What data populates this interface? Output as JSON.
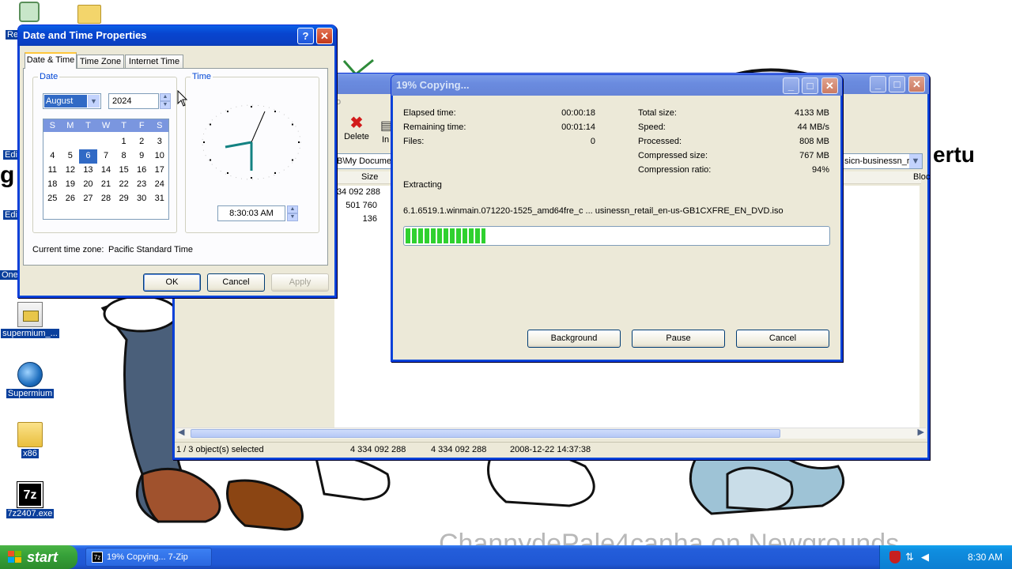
{
  "desktop": {
    "icons": [
      {
        "label": "supermium_...",
        "icon": "installer-icon"
      },
      {
        "label": "Supermium",
        "icon": "browser-icon"
      },
      {
        "label": "x86",
        "icon": "folder-icon"
      },
      {
        "label": "7z2407.exe",
        "icon": "7zip-icon"
      }
    ],
    "cut_labels": [
      "Re",
      "Edi",
      "Edi",
      "One"
    ],
    "wallpaper_text": "ChannydePale4canha on Newgrounds",
    "bg_word": "ertu"
  },
  "datetime": {
    "title": "Date and Time Properties",
    "tabs": [
      "Date & Time",
      "Time Zone",
      "Internet Time"
    ],
    "date_legend": "Date",
    "time_legend": "Time",
    "month": "August",
    "year": "2024",
    "weekdays": [
      "S",
      "M",
      "T",
      "W",
      "T",
      "F",
      "S"
    ],
    "calendar_rows": [
      [
        "",
        "",
        "",
        "",
        "1",
        "2",
        "3"
      ],
      [
        "4",
        "5",
        "6",
        "7",
        "8",
        "9",
        "10"
      ],
      [
        "11",
        "12",
        "13",
        "14",
        "15",
        "16",
        "17"
      ],
      [
        "18",
        "19",
        "20",
        "21",
        "22",
        "23",
        "24"
      ],
      [
        "25",
        "26",
        "27",
        "28",
        "29",
        "30",
        "31"
      ]
    ],
    "selected_day": "6",
    "time_value": "8:30:03 AM",
    "timezone_label": "Current time zone:",
    "timezone_value": "Pacific Standard Time",
    "ok": "OK",
    "cancel": "Cancel",
    "apply": "Apply",
    "help_glyph": "?",
    "close_glyph": "✕"
  },
  "sevenzip": {
    "toolbar_delete": "Delete",
    "toolbar_info": "In",
    "path": "B\\My Documen",
    "path_right": "sicn-businessn_re",
    "col_size": "Size",
    "col_block": "Bloc",
    "sizes": [
      "34 092 288",
      "501 760",
      "136"
    ],
    "tab_stub": "o",
    "status": [
      "1 / 3 object(s) selected",
      "4 334 092 288",
      "4 334 092 288",
      "2008-12-22 14:37:38"
    ]
  },
  "copying": {
    "title": "19% Copying...",
    "elapsed_label": "Elapsed time:",
    "elapsed_value": "00:00:18",
    "remaining_label": "Remaining time:",
    "remaining_value": "00:01:14",
    "files_label": "Files:",
    "files_value": "0",
    "total_label": "Total size:",
    "total_value": "4133 MB",
    "speed_label": "Speed:",
    "speed_value": "44 MB/s",
    "processed_label": "Processed:",
    "processed_value": "808 MB",
    "compressed_label": "Compressed size:",
    "compressed_value": "767 MB",
    "ratio_label": "Compression ratio:",
    "ratio_value": "94%",
    "operation": "Extracting",
    "filename": "6.1.6519.1.winmain.071220-1525_amd64fre_c ... usinessn_retail_en-us-GB1CXFRE_EN_DVD.iso",
    "progress": 0.19,
    "background_btn": "Background",
    "pause_btn": "Pause",
    "cancel_btn": "Cancel"
  },
  "taskbar": {
    "start": "start",
    "task_label": "19% Copying... 7-Zip",
    "clock": "8:30 AM"
  }
}
